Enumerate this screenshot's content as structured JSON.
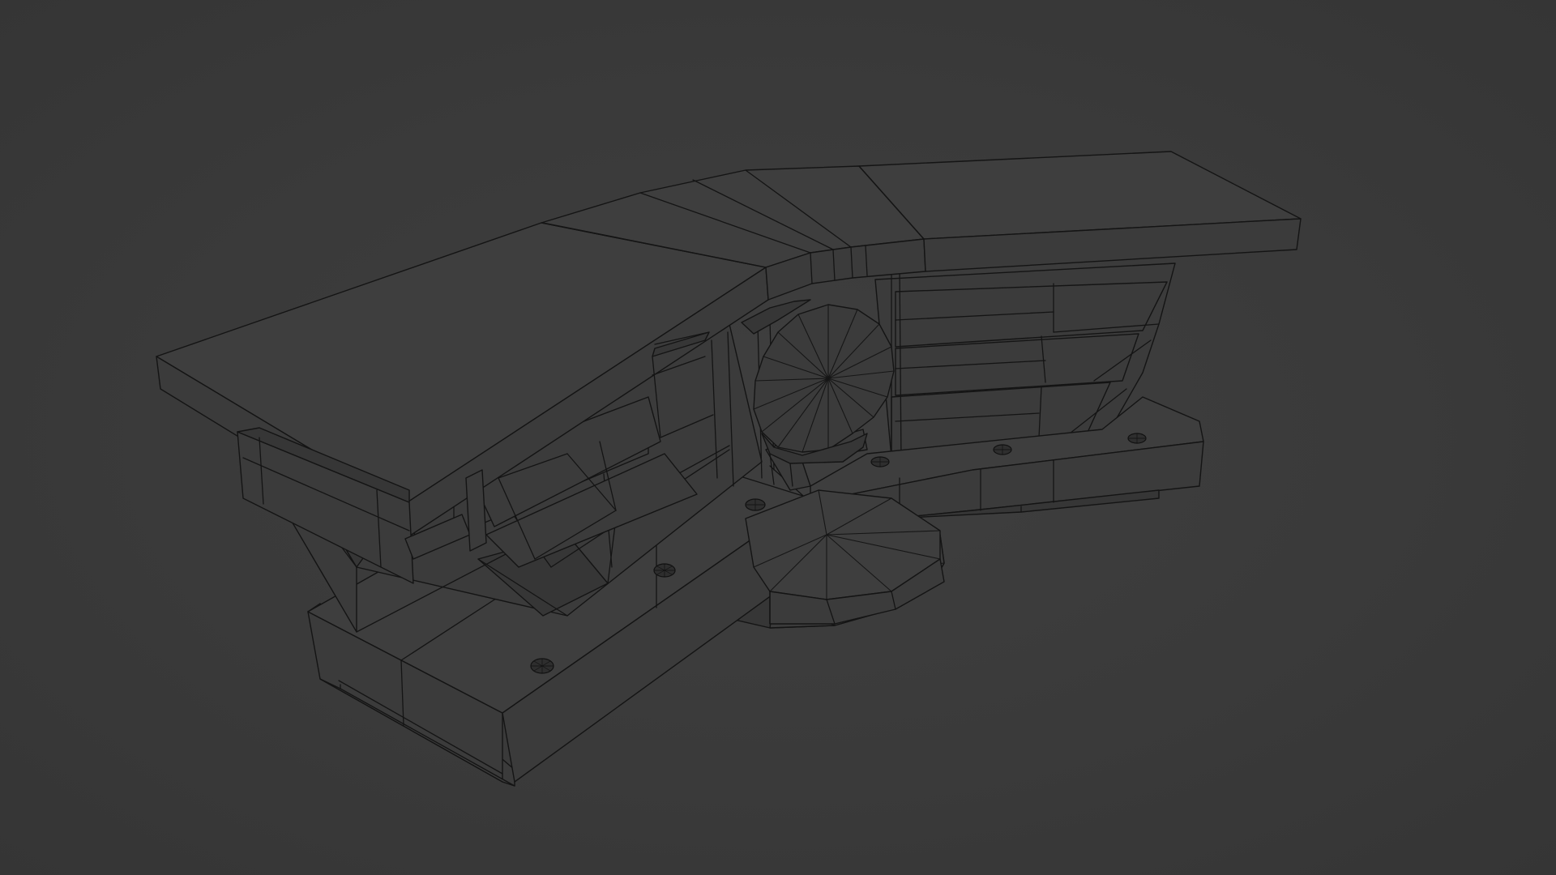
{
  "scene": {
    "object_type": "wireframe-3d-mesh",
    "display_mode": "wireframe",
    "background_color": "#3a3a3a",
    "wire_color": "#141414",
    "face_color": "#3b3b3b"
  }
}
